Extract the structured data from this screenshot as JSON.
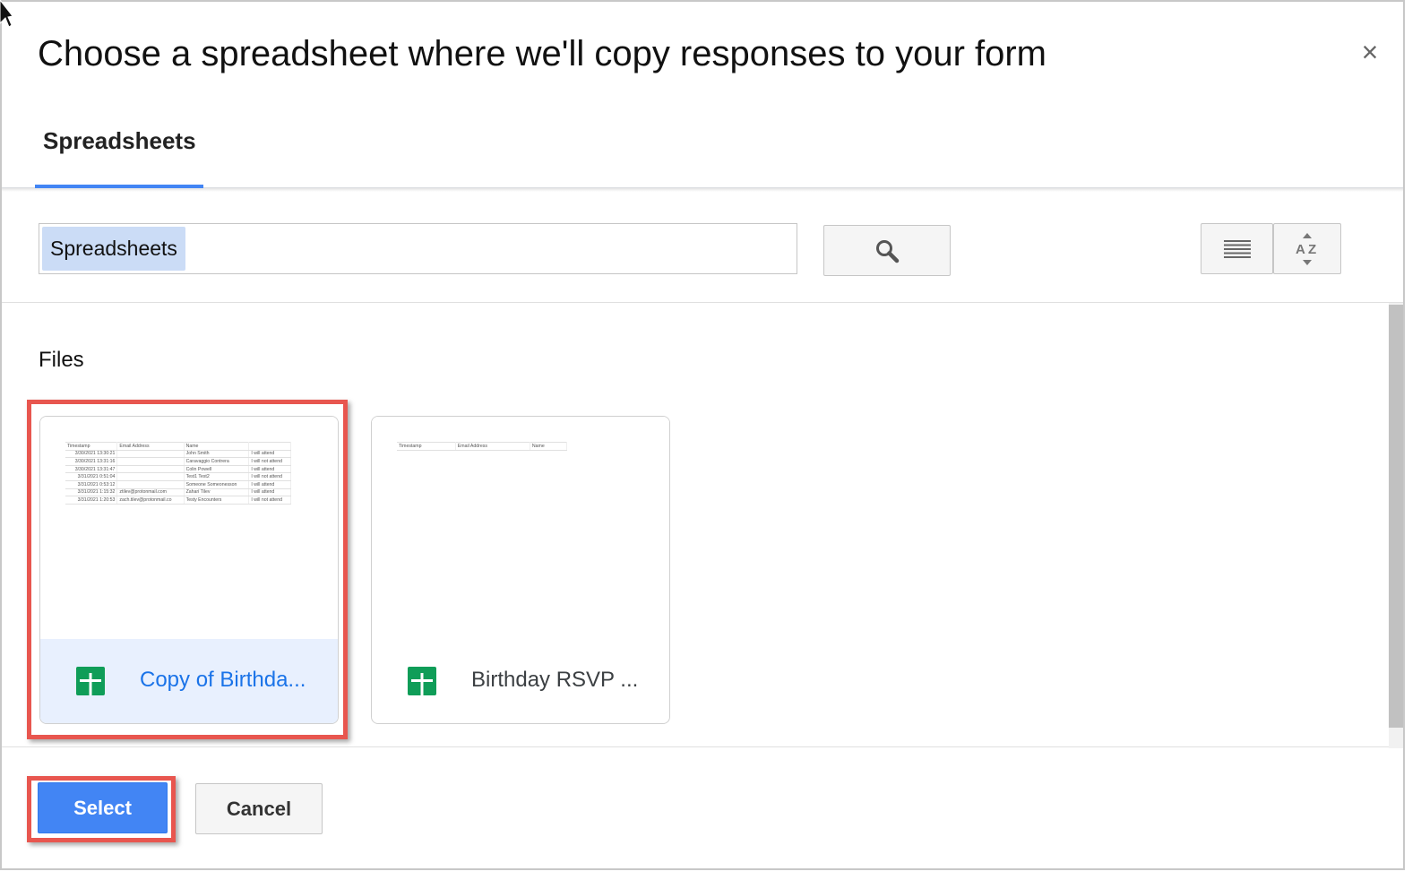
{
  "dialog": {
    "title": "Choose a spreadsheet where we'll copy responses to your form",
    "close_symbol": "×"
  },
  "tabs": [
    {
      "label": "Spreadsheets",
      "active": true
    }
  ],
  "search": {
    "chip": "Spreadsheets",
    "search_icon": "search-icon"
  },
  "toolbar": {
    "list_view_icon": "list-view-icon",
    "sort_icon": "sort-az-icon"
  },
  "files_section": {
    "label": "Files",
    "files": [
      {
        "name": "Copy of Birthda...",
        "icon": "google-sheets-icon",
        "selected": true,
        "preview": {
          "headers": [
            "Timestamp",
            "Email Address",
            "Name",
            ""
          ],
          "rows": [
            [
              "3/30/2021 13:30:21",
              "",
              "John Smith",
              "I will attend"
            ],
            [
              "3/30/2021 13:31:16",
              "",
              "Caravaggio Contrera",
              "I will not attend"
            ],
            [
              "3/30/2021 13:31:47",
              "",
              "Colin Powell",
              "I will attend"
            ],
            [
              "3/31/2021 0:51:04",
              "",
              "Test1 Test2",
              "I will not attend"
            ],
            [
              "3/31/2021 0:53:12",
              "",
              "Someone Someonesson",
              "I will attend"
            ],
            [
              "3/31/2021 1:15:32",
              "ztilev@protonmail.com",
              "Zahari Tilev",
              "I will attend"
            ],
            [
              "3/31/2021 1:20:53",
              "zach.tilev@protonmail.co",
              "Testy Encounters",
              "I will not attend"
            ]
          ]
        }
      },
      {
        "name": "Birthday RSVP ...",
        "icon": "google-sheets-icon",
        "selected": false,
        "preview": {
          "headers": [
            "Timestamp",
            "Email Address",
            "Name"
          ],
          "rows": []
        }
      }
    ]
  },
  "footer": {
    "select_label": "Select",
    "cancel_label": "Cancel"
  },
  "colors": {
    "accent": "#4285f4",
    "highlight": "#e8564f",
    "sheets_green": "#0f9d58",
    "selected_bg": "#e8f0fe",
    "link_blue": "#1a73e8"
  }
}
